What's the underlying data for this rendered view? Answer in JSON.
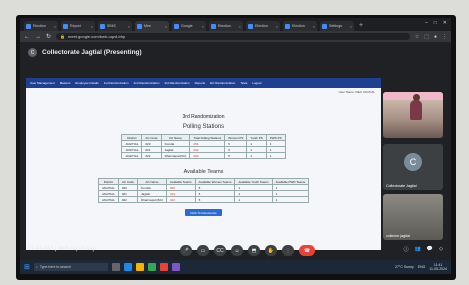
{
  "browser": {
    "tabs": [
      {
        "label": "Election",
        "active": false
      },
      {
        "label": "Report",
        "active": false
      },
      {
        "label": "IEMS",
        "active": false
      },
      {
        "label": "Mee",
        "active": true
      },
      {
        "label": "Google",
        "active": false
      },
      {
        "label": "Election",
        "active": false
      },
      {
        "label": "Election",
        "active": false
      },
      {
        "label": "Election",
        "active": false
      },
      {
        "label": "Settings",
        "active": false
      }
    ],
    "new_tab_label": "+",
    "url": "meet.google.com/bwh-oqzd-bhp"
  },
  "meeting": {
    "presenter_initial": "C",
    "header": "Collectorate Jagtial (Presenting)",
    "time": "11:41 AM",
    "code": "bwh-oqzd-bhp"
  },
  "app": {
    "nav_items": [
      "User Management",
      "Masters",
      "Employee Details",
      "1st Randomization",
      "2nd Randomization",
      "3rd Randomization",
      "Reports",
      "EO Randomization",
      "Tests",
      "Logout"
    ],
    "user_line": "User Name: DEO JAGTIAL",
    "page_title": "3rd Randomization",
    "polling_stations": {
      "heading": "Polling Stations",
      "headers": [
        "District",
        "AC Code",
        "AC Name",
        "Total Polling Stations",
        "Women PS",
        "Youth PS",
        "PWD PS"
      ],
      "rows": [
        [
          "JAGITIAL",
          "020",
          "Korutla",
          "254",
          "5",
          "1",
          "1"
        ],
        [
          "JAGITIAL",
          "021",
          "Jagtial",
          "262",
          "5",
          "1",
          "1"
        ],
        [
          "JAGITIAL",
          "022",
          "Dharmapuri(SC)",
          "269",
          "5",
          "1",
          "1"
        ]
      ]
    },
    "available_teams": {
      "heading": "Available Teams",
      "headers": [
        "District",
        "AC Code",
        "AC Name",
        "Available Teams",
        "Available Women Teams",
        "Available Youth Teams",
        "Available PWD Teams"
      ],
      "rows": [
        [
          "JAGITIAL",
          "020",
          "Korutla",
          "305",
          "5",
          "1",
          "1"
        ],
        [
          "JAGITIAL",
          "021",
          "Jagtial",
          "314",
          "5",
          "1",
          "1"
        ],
        [
          "JAGITIAL",
          "022",
          "Dharmapuri(SC)",
          "322",
          "5",
          "1",
          "1"
        ]
      ]
    },
    "button_label": "Click To Randomize"
  },
  "participants": [
    {
      "name": ""
    },
    {
      "name": "Collectorate Jagtial",
      "initial": "C"
    },
    {
      "name": "collector jagtial"
    }
  ],
  "taskbar": {
    "search_placeholder": "Type here to search",
    "weather": "27°C Sunny",
    "lang": "ENG",
    "clock_time": "11:41",
    "clock_date": "11-05-2024"
  },
  "colors": {
    "app_header": "#1f3f8f",
    "end_call": "#ea4335",
    "meet_bg": "#202124"
  }
}
